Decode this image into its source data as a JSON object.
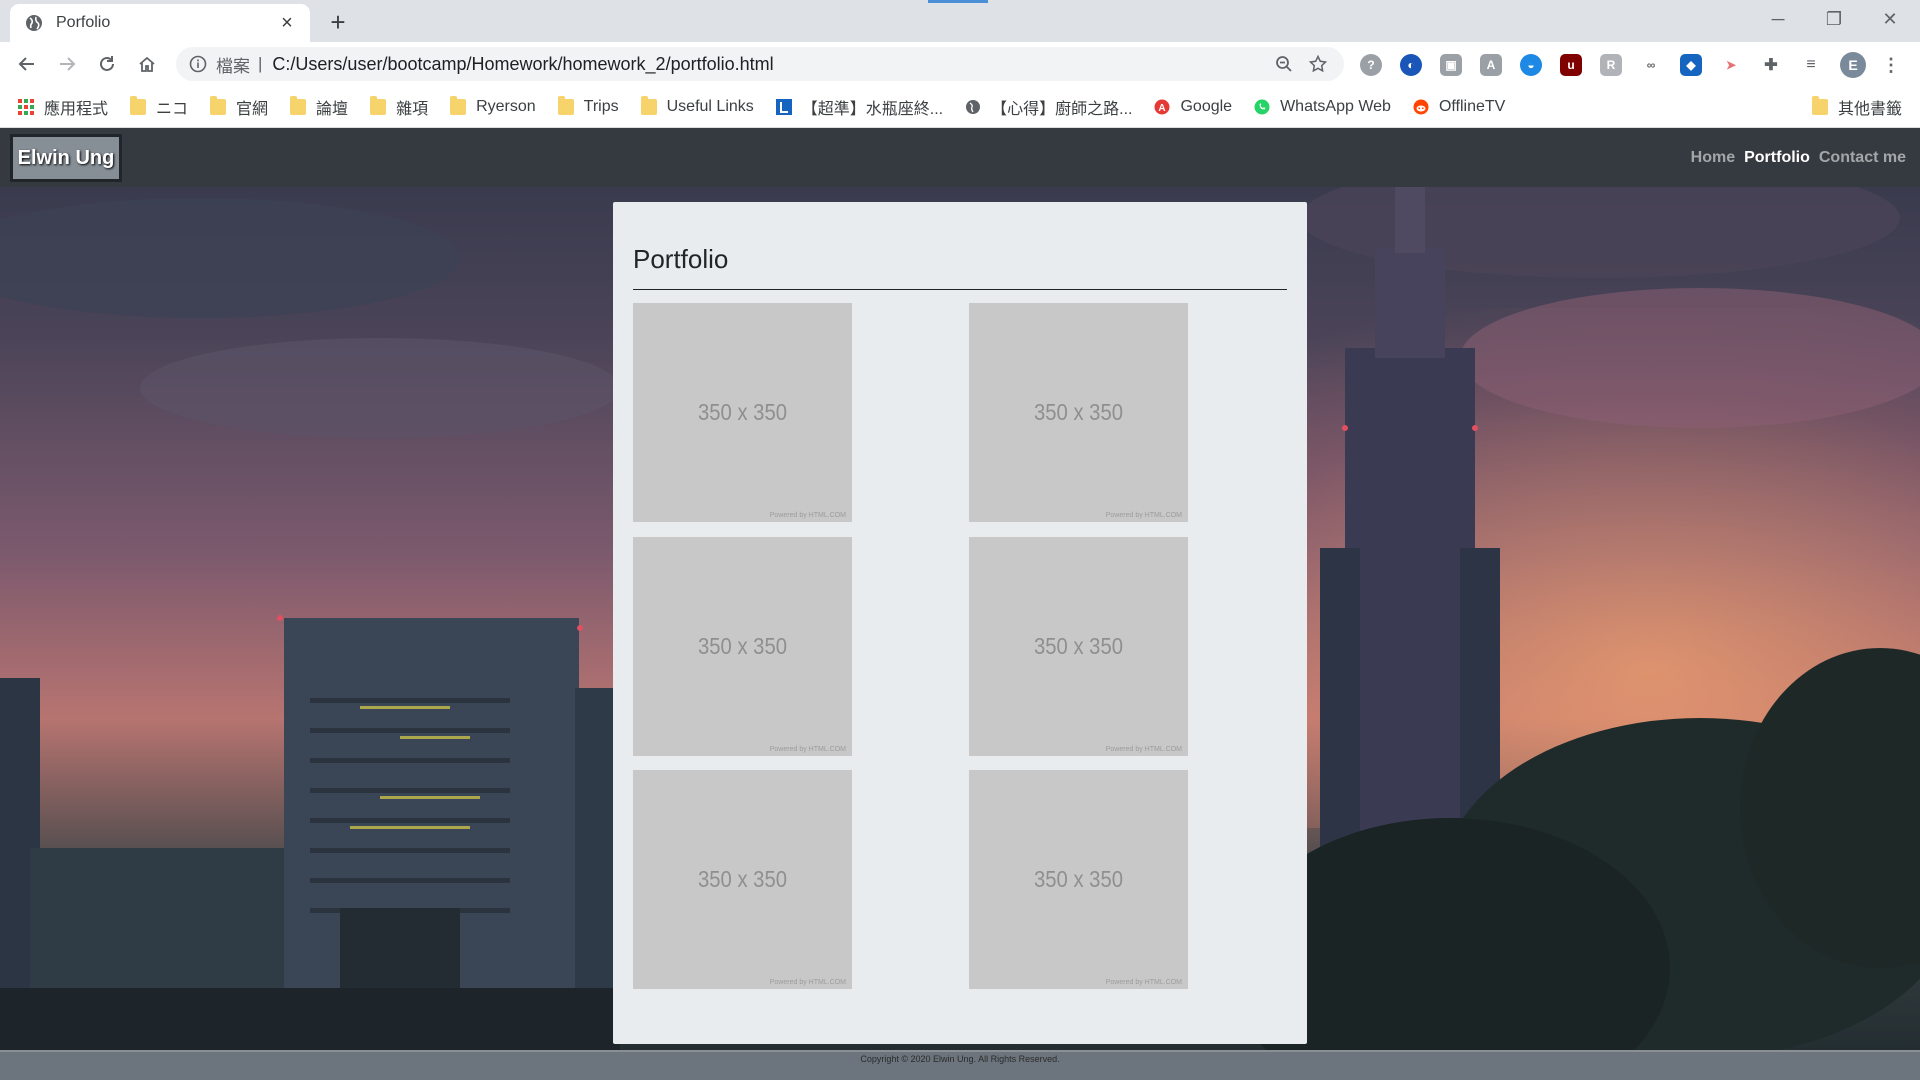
{
  "browser": {
    "tab_title": "Porfolio",
    "tab_close": "×",
    "new_tab": "+",
    "window_controls": {
      "minimize": "─",
      "restore": "❐",
      "close": "✕"
    },
    "address": {
      "scheme_label": "檔案",
      "separator": "|",
      "url": "C:/Users/user/bootcamp/Homework/homework_2/portfolio.html"
    },
    "profile_initial": "E",
    "bookmarks": [
      {
        "label": "應用程式",
        "icon": "apps-grid-icon"
      },
      {
        "label": "ニコ",
        "icon": "folder-icon"
      },
      {
        "label": "官網",
        "icon": "folder-icon"
      },
      {
        "label": "論壇",
        "icon": "folder-icon"
      },
      {
        "label": "雜項",
        "icon": "folder-icon"
      },
      {
        "label": "Ryerson",
        "icon": "folder-icon"
      },
      {
        "label": "Trips",
        "icon": "folder-icon"
      },
      {
        "label": "Useful Links",
        "icon": "folder-icon"
      },
      {
        "label": "【超準】水瓶座終...",
        "icon": "l-site-icon"
      },
      {
        "label": "【心得】廚師之路...",
        "icon": "globe-icon"
      },
      {
        "label": "Google",
        "icon": "google-icon"
      },
      {
        "label": "WhatsApp Web",
        "icon": "whatsapp-icon"
      },
      {
        "label": "OfflineTV",
        "icon": "reddit-icon"
      }
    ],
    "other_bookmarks": "其他書籤"
  },
  "site": {
    "brand": "Elwin Ung",
    "nav": [
      {
        "label": "Home",
        "active": false
      },
      {
        "label": "Portfolio",
        "active": true
      },
      {
        "label": "Contact me",
        "active": false
      }
    ]
  },
  "portfolio": {
    "heading": "Portfolio",
    "thumbnails": [
      {
        "text": "350 x 350",
        "credit": "Powered by HTML.COM"
      },
      {
        "text": "350 x 350",
        "credit": "Powered by HTML.COM"
      },
      {
        "text": "350 x 350",
        "credit": "Powered by HTML.COM"
      },
      {
        "text": "350 x 350",
        "credit": "Powered by HTML.COM"
      },
      {
        "text": "350 x 350",
        "credit": "Powered by HTML.COM"
      },
      {
        "text": "350 x 350",
        "credit": "Powered by HTML.COM"
      }
    ]
  },
  "footer": {
    "copyright": "Copyright © 2020 Elwin Ung. All Rights Reserved."
  },
  "colors": {
    "navbar": "#343a40",
    "card": "#e9ecef",
    "placeholder": "#c8c8c8",
    "footer": "#6c757d"
  }
}
